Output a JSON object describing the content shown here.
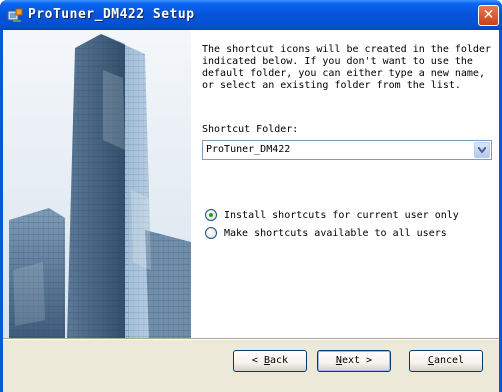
{
  "window": {
    "title": "ProTuner_DM422 Setup",
    "close_glyph": "✕"
  },
  "content": {
    "intro": "The shortcut icons will be created in the folder indicated below. If you don't want to use the default folder, you can either type a new name, or select an existing folder from the list.",
    "folder_label": "Shortcut Folder:",
    "folder_value": "ProTuner_DM422",
    "radio_current_user": "Install shortcuts for current user only",
    "radio_all_users": "Make shortcuts available to all users",
    "selected_option": "current_user"
  },
  "buttons": {
    "back": {
      "mnemonic": "B",
      "rest": "ack",
      "prefix": "< "
    },
    "next": {
      "mnemonic": "N",
      "rest": "ext",
      "suffix": " >"
    },
    "cancel": {
      "mnemonic": "C",
      "rest": "ancel"
    }
  },
  "colors": {
    "title_bar": "#0653d9",
    "dialog_bg": "#ece9d8",
    "radio_dot": "#21a121"
  }
}
